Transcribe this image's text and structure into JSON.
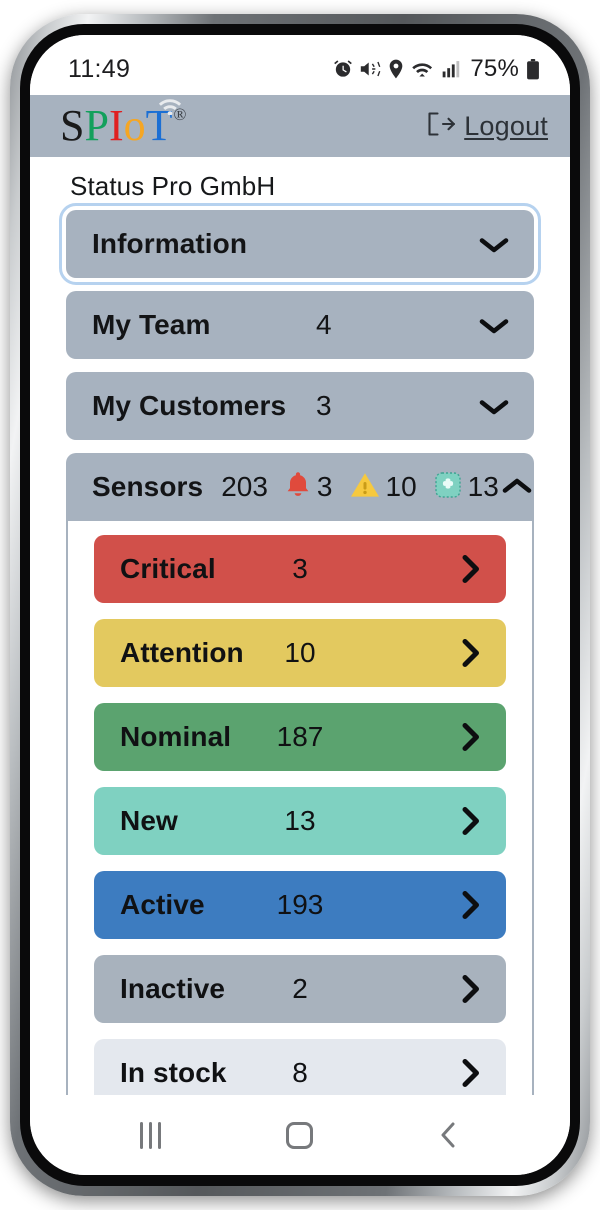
{
  "status_bar": {
    "time": "11:49",
    "battery_percent": "75%",
    "icons": [
      "alarm-clock-icon",
      "vibrate-mute-icon",
      "location-pin-icon",
      "wifi-icon",
      "cellular-signal-icon",
      "battery-icon"
    ]
  },
  "header": {
    "brand": {
      "letters": [
        "S",
        "P",
        "I",
        "o",
        "T"
      ],
      "registered_mark": "®",
      "colors": {
        "S": "#1a1a1a",
        "P": "#13a05c",
        "I": "#e02020",
        "o": "#f5a623",
        "T": "#1b6fd4"
      }
    },
    "logout_label": "Logout",
    "background_color": "#a7b2bf"
  },
  "org_name": "Status Pro GmbH",
  "accordion": [
    {
      "id": "information",
      "label": "Information",
      "count": "",
      "expanded": false,
      "selected": true,
      "chevron": "chevron-down-icon"
    },
    {
      "id": "my-team",
      "label": "My Team",
      "count": "4",
      "expanded": false,
      "selected": false,
      "chevron": "chevron-down-icon"
    },
    {
      "id": "my-customers",
      "label": "My Customers",
      "count": "3",
      "expanded": false,
      "selected": false,
      "chevron": "chevron-down-icon"
    }
  ],
  "sensors": {
    "label": "Sensors",
    "total": "203",
    "expanded": true,
    "chevron": "chevron-up-icon",
    "badges": [
      {
        "icon": "bell-alert-icon",
        "color": "#e04a3c",
        "value": "3"
      },
      {
        "icon": "warning-triangle-icon",
        "color": "#f6c93f",
        "value": "10"
      },
      {
        "icon": "new-sensor-icon",
        "color": "#7fd1c1",
        "value": "13"
      }
    ],
    "rows": [
      {
        "label": "Critical",
        "value": "3",
        "color": "#d1504a",
        "text_color": "#101113",
        "arrow": "chevron-right-icon"
      },
      {
        "label": "Attention",
        "value": "10",
        "color": "#e3c95f",
        "text_color": "#101113",
        "arrow": "chevron-right-icon"
      },
      {
        "label": "Nominal",
        "value": "187",
        "color": "#5ba36f",
        "text_color": "#101113",
        "arrow": "chevron-right-icon"
      },
      {
        "label": "New",
        "value": "13",
        "color": "#7fd1c1",
        "text_color": "#101113",
        "arrow": "chevron-right-icon"
      },
      {
        "label": "Active",
        "value": "193",
        "color": "#3d7cc0",
        "text_color": "#101113",
        "arrow": "chevron-right-icon"
      },
      {
        "label": "Inactive",
        "value": "2",
        "color": "#a8b2bd",
        "text_color": "#101113",
        "arrow": "chevron-right-icon"
      },
      {
        "label": "In stock",
        "value": "8",
        "color": "#e4e8ee",
        "text_color": "#101113",
        "arrow": "chevron-right-icon"
      }
    ]
  },
  "nav_bar": {
    "recents_label": "recents-icon",
    "home_label": "home-icon",
    "back_label": "back-icon"
  }
}
